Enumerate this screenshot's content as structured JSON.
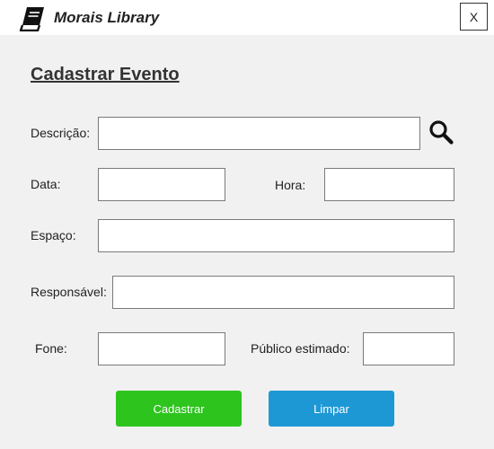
{
  "window": {
    "title": "Morais Library",
    "close_label": "X"
  },
  "form": {
    "title": "Cadastrar Evento",
    "fields": {
      "descricao": {
        "label": "Descrição:",
        "value": "",
        "placeholder": ""
      },
      "data": {
        "label": "Data:",
        "value": "",
        "placeholder": ""
      },
      "hora": {
        "label": "Hora:",
        "value": "",
        "placeholder": ""
      },
      "espaco": {
        "label": "Espaço:",
        "value": "",
        "placeholder": ""
      },
      "responsavel": {
        "label": "Responsável:",
        "value": "",
        "placeholder": ""
      },
      "fone": {
        "label": "Fone:",
        "value": "",
        "placeholder": ""
      },
      "publico": {
        "label": "Público estimado:",
        "value": "",
        "placeholder": ""
      }
    },
    "search_icon": "search-icon"
  },
  "actions": {
    "cadastrar_label": "Cadastrar",
    "limpar_label": "Limpar"
  },
  "colors": {
    "background": "#f1f1f1",
    "titlebar": "#ffffff",
    "cadastrar": "#2dc41e",
    "limpar": "#1e98d5"
  }
}
